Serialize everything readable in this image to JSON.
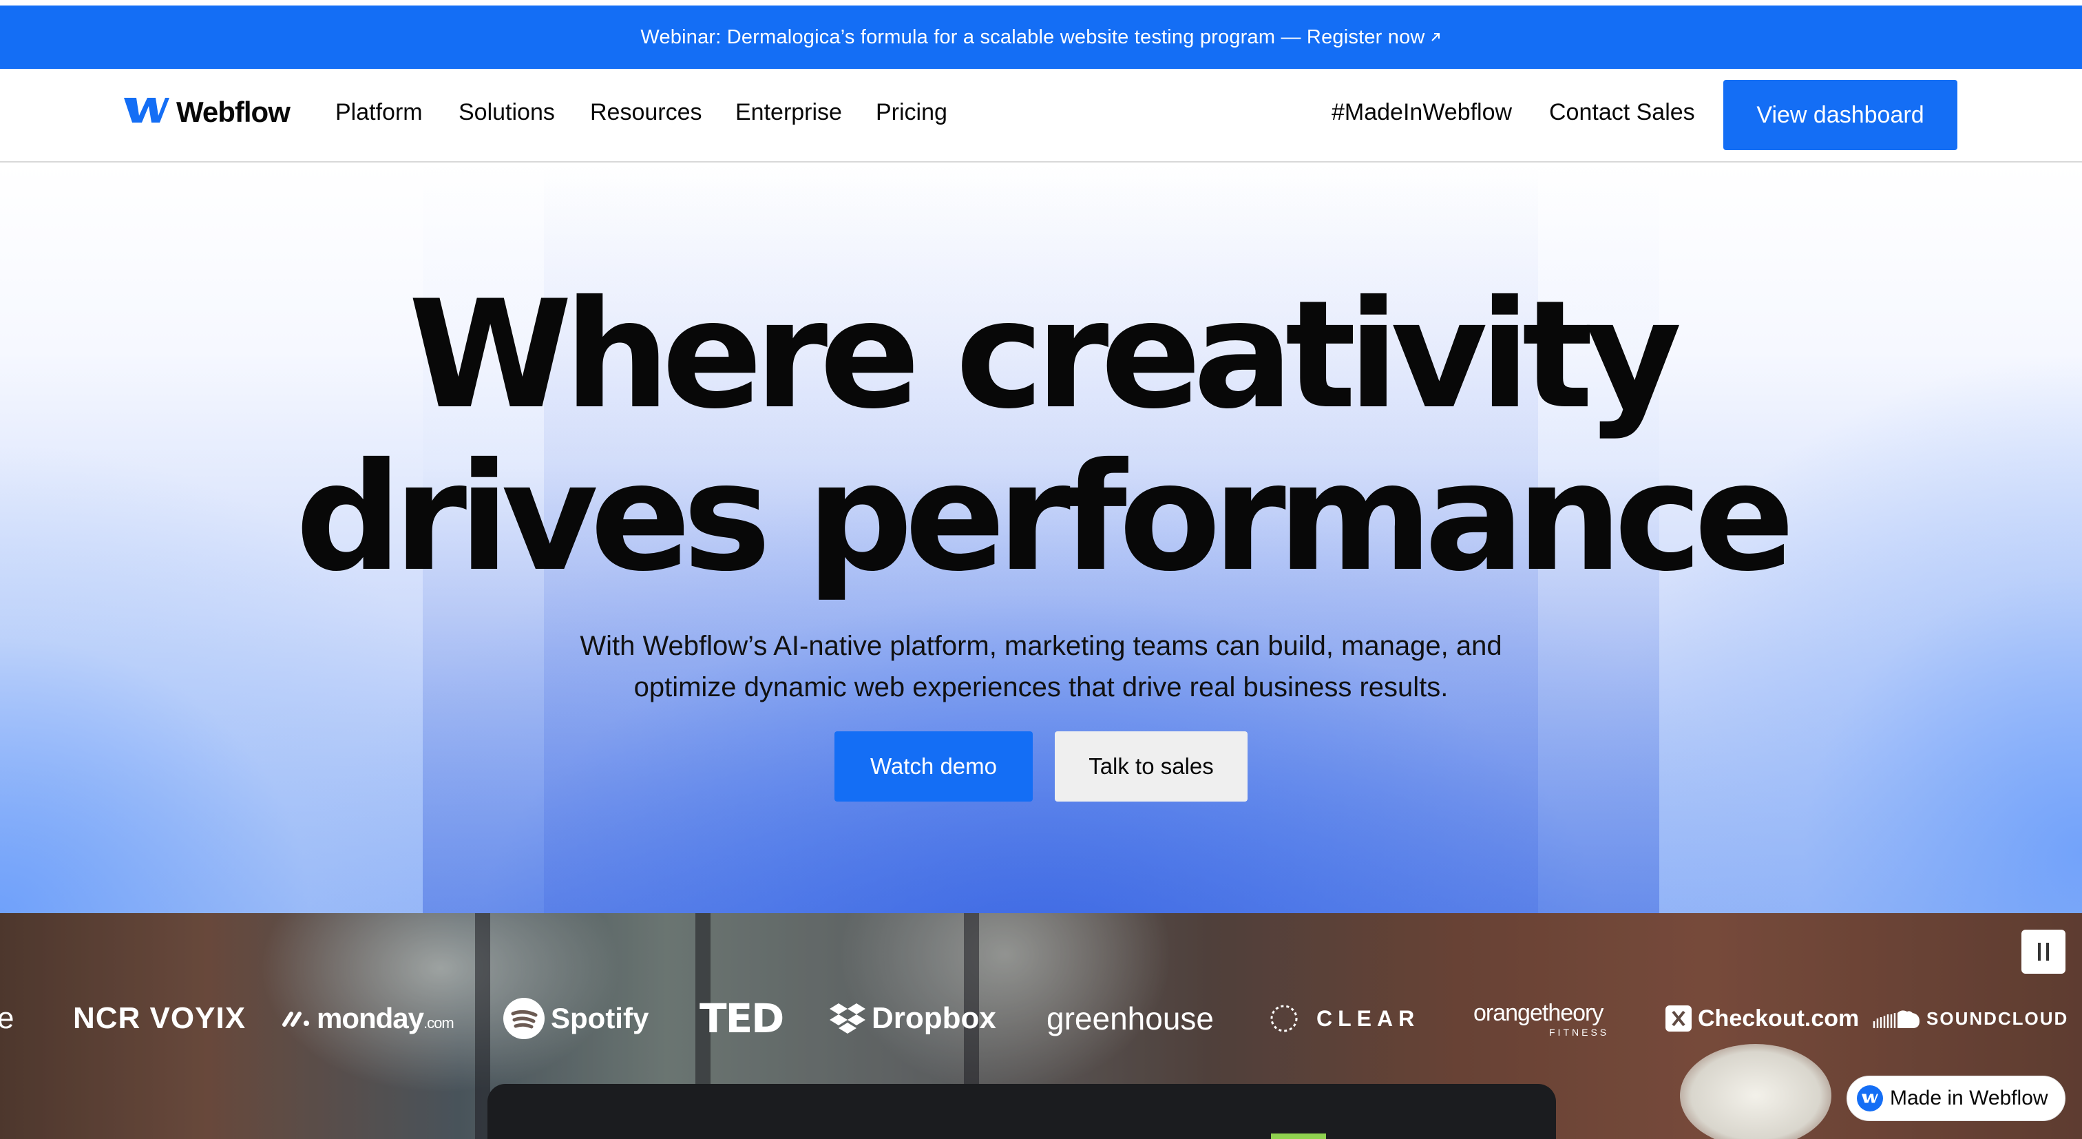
{
  "banner": {
    "text": "Webinar: Dermalogica’s formula for a scalable website testing program — Register now",
    "arrow_icon": "arrow-up-right-icon"
  },
  "nav": {
    "logo_text": "Webflow",
    "items": [
      {
        "label": "Platform"
      },
      {
        "label": "Solutions"
      },
      {
        "label": "Resources"
      },
      {
        "label": "Enterprise"
      },
      {
        "label": "Pricing"
      }
    ],
    "right_items": [
      {
        "label": "#MadeInWebflow"
      },
      {
        "label": "Contact Sales"
      }
    ],
    "dashboard_label": "View dashboard"
  },
  "hero": {
    "headline_line1": "Where creativity",
    "headline_line2": "drives performance",
    "subtitle_line1": "With Webflow’s AI-native platform, marketing teams can build, manage, and",
    "subtitle_line2": "optimize dynamic web experiences that drive real business results.",
    "primary_cta": "Watch demo",
    "secondary_cta": "Talk to sales"
  },
  "logos": [
    {
      "name": "e"
    },
    {
      "name": "NCR VOYIX"
    },
    {
      "name": "monday",
      "suffix": ".com"
    },
    {
      "name": "Spotify"
    },
    {
      "name": "TED"
    },
    {
      "name": "Dropbox"
    },
    {
      "name": "greenhouse"
    },
    {
      "name": "CLEAR"
    },
    {
      "name": "orangetheory",
      "suffix": "FITNESS"
    },
    {
      "name": "Checkout.com"
    },
    {
      "name": "SOUNDCLOUD"
    }
  ],
  "pause_icon": "pause-icon",
  "made_in_badge": "Made in Webflow",
  "colors": {
    "brand_blue": "#146ef5",
    "text_dark": "#080808",
    "secondary_button": "#efefef"
  }
}
